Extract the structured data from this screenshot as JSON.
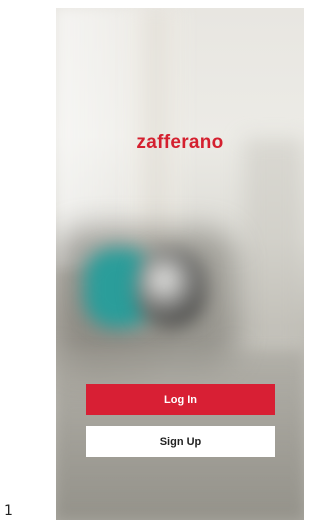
{
  "page_number": "1",
  "app": {
    "logo_text": "zafferano"
  },
  "actions": {
    "login_label": "Log In",
    "signup_label": "Sign Up"
  },
  "colors": {
    "brand": "#d4202f",
    "login_button": "#d81f34",
    "signup_button": "#ffffff"
  }
}
